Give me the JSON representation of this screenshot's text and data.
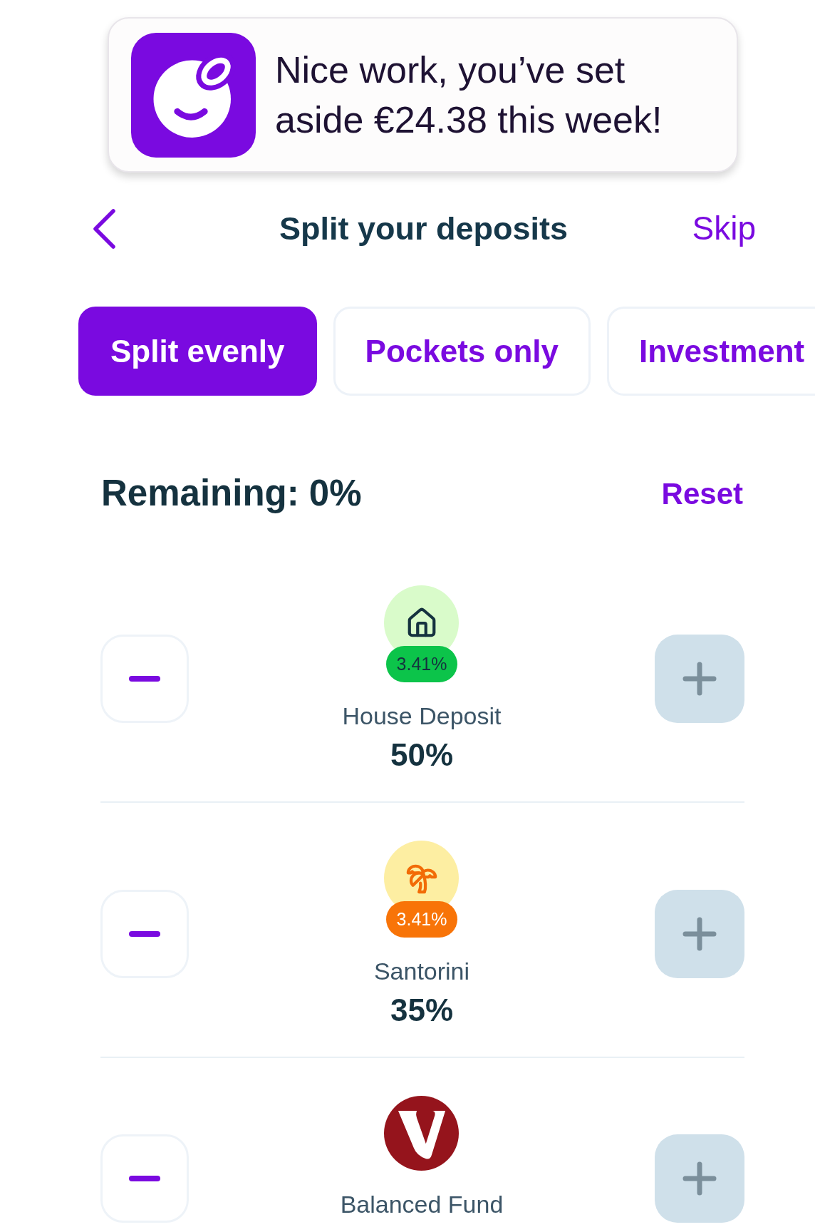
{
  "notification": {
    "message": "Nice work, you’ve set aside €24.38 this week!"
  },
  "header": {
    "title": "Split your deposits",
    "skip": "Skip"
  },
  "tabs": [
    {
      "label": "Split evenly",
      "selected": true
    },
    {
      "label": "Pockets only",
      "selected": false
    },
    {
      "label": "Investment",
      "selected": false
    }
  ],
  "summary": {
    "remaining": "Remaining: 0%",
    "reset": "Reset"
  },
  "allocations": [
    {
      "kind": "house_pocket",
      "name": "House Deposit",
      "share": "50%",
      "color": "#d9fbca",
      "badge": {
        "label": "3.41%",
        "color": "#0cc44a"
      }
    },
    {
      "kind": "holiday_pocket",
      "name": "Santorini",
      "share": "35%",
      "color": "#fdeea2",
      "badge": {
        "label": "3.41%",
        "color": "#f87408"
      }
    },
    {
      "kind": "fund",
      "name": "Balanced Fund"
    }
  ]
}
